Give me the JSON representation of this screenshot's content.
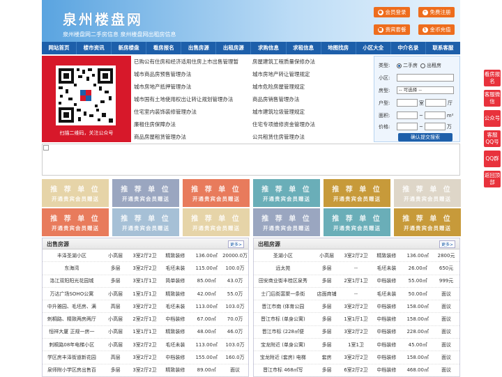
{
  "header": {
    "logo": "泉州楼盘网",
    "subtitle": "泉州楼盘网二手房信息    泉州楼盘网出租房信息",
    "buttons": [
      {
        "label": "会员登录",
        "icon": "user-icon"
      },
      {
        "label": "免费注册",
        "icon": "user-plus-icon"
      },
      {
        "label": "贵宾套餐",
        "icon": "gift-icon"
      },
      {
        "label": "金币充值",
        "icon": "coin-icon"
      }
    ]
  },
  "nav": [
    "网站首页",
    "楼市资讯",
    "新房楼盘",
    "看房报名",
    "出售房源",
    "出租房源",
    "求购信息",
    "求租信息",
    "地图找房",
    "小区大全",
    "中介名录",
    "联系客服"
  ],
  "qr": {
    "caption": "扫描二维码，关注公众号"
  },
  "links": [
    [
      "已购公有住房和经济适用住房上市出售管理暂",
      "房屋建筑工程质量保修办法"
    ],
    [
      "城市商品房预售管理办法",
      "城市房地产转让管理规定"
    ],
    [
      "城市房地产抵押管理办法",
      "城市危险房屋管理规定"
    ],
    [
      "城市国有土地使用权出让转让规划管理办法",
      "商品房销售管理办法"
    ],
    [
      "住宅室内装饰装修管理办法",
      "城市建筑垃圾管理规定"
    ],
    [
      "廉租住房保障办法",
      "住宅专项维修资金管理办法"
    ],
    [
      "商品房屋租赁管理办法",
      "公共租赁住房管理办法"
    ]
  ],
  "search": {
    "type_label": "类型:",
    "type_options": [
      "二手房",
      "出租房"
    ],
    "community_label": "小区:",
    "housetype_label": "房型:",
    "housetype_value": "-- 可选择 --",
    "layout_label": "户型:",
    "room_unit": "室",
    "hall_unit": "厅",
    "area_label": "面积:",
    "area_sep": "~",
    "area_unit": "m²",
    "price_label": "价格:",
    "price_sep": "~",
    "price_unit": "万",
    "submit": "确认提交搜索"
  },
  "ads": {
    "title": "推 荐 单 位",
    "sub": "开通贵宾会员赠送",
    "colors": [
      "#e6d4a8",
      "#9aa6c0",
      "#e87b5c",
      "#6aaeb8",
      "#c79a3a",
      "#ded6c8",
      "#e87b5c",
      "#a6c0d6",
      "#e6d4a8",
      "#9aa6c0",
      "#6aaeb8",
      "#c79a3a"
    ]
  },
  "sale": {
    "title": "出售房源",
    "more": "更多>",
    "rows": [
      [
        "丰泽圣湖小区",
        "小高层",
        "3室2厅2卫",
        "精致装修",
        "136.00㎡",
        "20000.0万"
      ],
      [
        "东海湾",
        "多层",
        "3室2厅2卫",
        "毛坯未装",
        "115.00㎡",
        "100.0万"
      ],
      [
        "洛江双阳阳光花园城",
        "多层",
        "3室1厅1卫",
        "简单装修",
        "85.00㎡",
        "43.0万"
      ],
      [
        "万达广场SOHO公寓",
        "小高层",
        "1室1厅1卫",
        "精致装修",
        "42.00㎡",
        "55.0万"
      ],
      [
        "中升雅园、毛坯房、满",
        "高层",
        "3室2厅2卫",
        "毛坯未装",
        "113.00㎡",
        "103.0万"
      ],
      [
        "刺桐路、精致两房两厅",
        "小高层",
        "2室2厅1卫",
        "中档装修",
        "67.00㎡",
        "70.0万"
      ],
      [
        "恒祥大厦 正规一房一",
        "小高层",
        "1室1厅1卫",
        "精致装修",
        "48.00㎡",
        "46.0万"
      ],
      [
        "刺桐路08年电梯小区",
        "小高层",
        "3室2厅2卫",
        "毛坯未装",
        "113.00㎡",
        "103.0万"
      ],
      [
        "学区房丰泽街道新花园",
        "高层",
        "3室2厅2卫",
        "中档装修",
        "155.00㎡",
        "160.0万"
      ],
      [
        "泉师附小学区房出售百",
        "多层",
        "3室2厅2卫",
        "精致装修",
        "89.00㎡",
        "面议"
      ]
    ]
  },
  "rent": {
    "title": "出租房源",
    "more": "更多>",
    "rows": [
      [
        "圣湖小区",
        "小高层",
        "3室2厅2卫",
        "精致装修",
        "136.00㎡",
        "2800元"
      ],
      [
        "远太苑",
        "多层",
        "--",
        "毛坯未装",
        "26.00㎡",
        "650元"
      ],
      [
        "田安商业街丰桂区泉秀",
        "多层",
        "2室1厅1卫",
        "中档装修",
        "55.00㎡",
        "999元"
      ],
      [
        "士门后街富聚一条街",
        "店面商铺",
        "--",
        "毛坯未装",
        "50.00㎡",
        "面议"
      ],
      [
        "晋江市南 (体育公园",
        "多层",
        "3室2厅2卫",
        "中档装修",
        "158.00㎡",
        "面议"
      ],
      [
        "晋江市标 (单身公寓)",
        "多层",
        "1室1厅1卫",
        "中档装修",
        "158.00㎡",
        "面议"
      ],
      [
        "晋江市标 (228㎡便",
        "多层",
        "3室2厅2卫",
        "中档装修",
        "228.00㎡",
        "面议"
      ],
      [
        "宝龙附近 (单身公寓)",
        "多层",
        "1室1卫",
        "中档装修",
        "45.00㎡",
        "面议"
      ],
      [
        "宝龙附近 (套房) 电梯",
        "套房",
        "3室2厅2卫",
        "中档装修",
        "158.00㎡",
        "面议"
      ],
      [
        "晋江市标 468㎡写",
        "多层",
        "6室2厅2卫",
        "中档装修",
        "468.00㎡",
        "面议"
      ]
    ]
  },
  "side": [
    "看房报名",
    "客服微信",
    "公众号",
    "客服QQ号",
    "QQ群",
    "返回顶部"
  ]
}
